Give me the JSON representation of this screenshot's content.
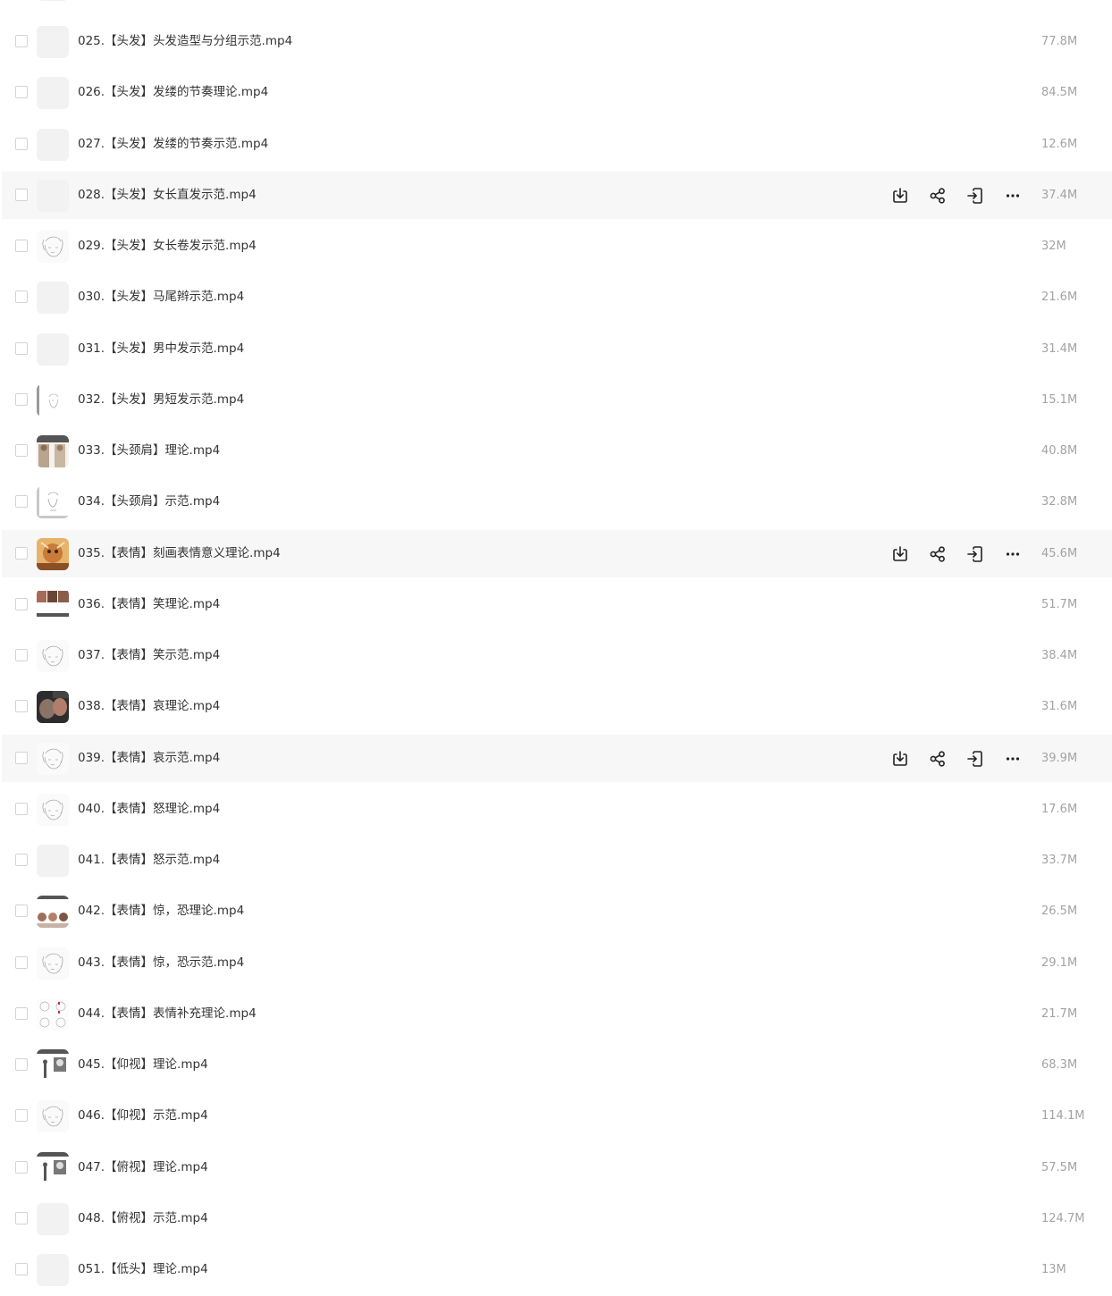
{
  "files": [
    {
      "name": "025.【头发】头发造型与分组示范.mp4",
      "size": "77.8M",
      "thumb": "blank"
    },
    {
      "name": "026.【头发】发缕的节奏理论.mp4",
      "size": "84.5M",
      "thumb": "blank"
    },
    {
      "name": "027.【头发】发缕的节奏示范.mp4",
      "size": "12.6M",
      "thumb": "blank"
    },
    {
      "name": "028.【头发】女长直发示范.mp4",
      "size": "37.4M",
      "thumb": "blank",
      "hover": true
    },
    {
      "name": "029.【头发】女长卷发示范.mp4",
      "size": "32M",
      "thumb": "sketch"
    },
    {
      "name": "030.【头发】马尾辫示范.mp4",
      "size": "21.6M",
      "thumb": "blank"
    },
    {
      "name": "031.【头发】男中发示范.mp4",
      "size": "31.4M",
      "thumb": "blank"
    },
    {
      "name": "032.【头发】男短发示范.mp4",
      "size": "15.1M",
      "thumb": "sketch-bar"
    },
    {
      "name": "033.【头颈肩】理论.mp4",
      "size": "40.8M",
      "thumb": "anatomy"
    },
    {
      "name": "034.【头颈肩】示范.mp4",
      "size": "32.8M",
      "thumb": "sketch-frame"
    },
    {
      "name": "035.【表情】刻画表情意义理论.mp4",
      "size": "45.6M",
      "thumb": "painting",
      "hover": true
    },
    {
      "name": "036.【表情】笑理论.mp4",
      "size": "51.7M",
      "thumb": "faces"
    },
    {
      "name": "037.【表情】笑示范.mp4",
      "size": "38.4M",
      "thumb": "sketch"
    },
    {
      "name": "038.【表情】哀理论.mp4",
      "size": "31.6M",
      "thumb": "photo"
    },
    {
      "name": "039.【表情】哀示范.mp4",
      "size": "39.9M",
      "thumb": "sketch",
      "hover": true
    },
    {
      "name": "040.【表情】怒理论.mp4",
      "size": "17.6M",
      "thumb": "sketch"
    },
    {
      "name": "041.【表情】怒示范.mp4",
      "size": "33.7M",
      "thumb": "blank"
    },
    {
      "name": "042.【表情】惊，恐理论.mp4",
      "size": "26.5M",
      "thumb": "faces-strip"
    },
    {
      "name": "043.【表情】惊，恐示范.mp4",
      "size": "29.1M",
      "thumb": "sketch"
    },
    {
      "name": "044.【表情】表情补充理论.mp4",
      "size": "21.7M",
      "thumb": "sketch-grid"
    },
    {
      "name": "045.【仰视】理论.mp4",
      "size": "68.3M",
      "thumb": "figure"
    },
    {
      "name": "046.【仰视】示范.mp4",
      "size": "114.1M",
      "thumb": "sketch"
    },
    {
      "name": "047.【俯视】理论.mp4",
      "size": "57.5M",
      "thumb": "figure"
    },
    {
      "name": "048.【俯视】示范.mp4",
      "size": "124.7M",
      "thumb": "blank"
    },
    {
      "name": "051.【低头】理论.mp4",
      "size": "13M",
      "thumb": "blank"
    }
  ],
  "actions": [
    {
      "name": "download-icon",
      "label": "下载"
    },
    {
      "name": "share-icon",
      "label": "分享"
    },
    {
      "name": "save-to-icon",
      "label": "转存"
    },
    {
      "name": "more-icon",
      "label": "更多"
    }
  ],
  "colors": {
    "text": "#333333",
    "size": "#a3a3a3",
    "hover_bg": "#f7f7f8",
    "thumb_bg": "#f2f2f3"
  }
}
